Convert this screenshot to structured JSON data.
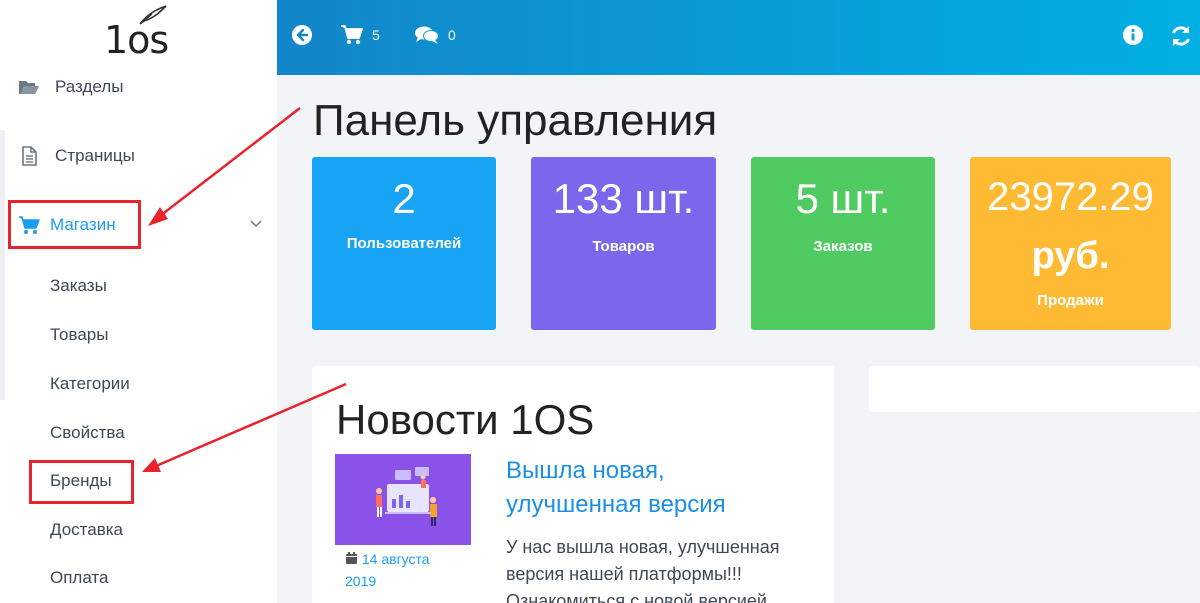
{
  "sidebar": {
    "logo_text": "1os",
    "items": [
      {
        "label": "Разделы"
      },
      {
        "label": "Страницы"
      },
      {
        "label": "Магазин"
      }
    ],
    "shop_subitems": [
      {
        "label": "Заказы"
      },
      {
        "label": "Товары"
      },
      {
        "label": "Категории"
      },
      {
        "label": "Свойства"
      },
      {
        "label": "Бренды"
      },
      {
        "label": "Доставка"
      },
      {
        "label": "Оплата"
      }
    ]
  },
  "topbar": {
    "cart_count": "5",
    "messages_count": "0"
  },
  "main": {
    "title": "Панель управления",
    "stats": {
      "users": {
        "value": "2",
        "label": "Пользователей"
      },
      "products": {
        "value": "133 шт.",
        "label": "Товаров"
      },
      "orders": {
        "value": "5 шт.",
        "label": "Заказов"
      },
      "sales": {
        "value": "23972.29",
        "unit": "руб.",
        "label": "Продажи"
      }
    },
    "news": {
      "title": "Новости 1OS",
      "item": {
        "headline": "Вышла новая, улучшенная версия",
        "date": "14 августа 2019",
        "text": "У нас вышла новая, улучшенная версия нашей платформы!!! Ознакомиться с новой версией"
      }
    }
  },
  "colors": {
    "accent": "#1a9df0",
    "topbar_start": "#1386c9",
    "topbar_end": "#00b0e4",
    "stat_users": "#18a4f5",
    "stat_products": "#7b67ec",
    "stat_orders": "#4fcb62",
    "stat_sales": "#ffba33",
    "annotation": "#e8232c"
  }
}
